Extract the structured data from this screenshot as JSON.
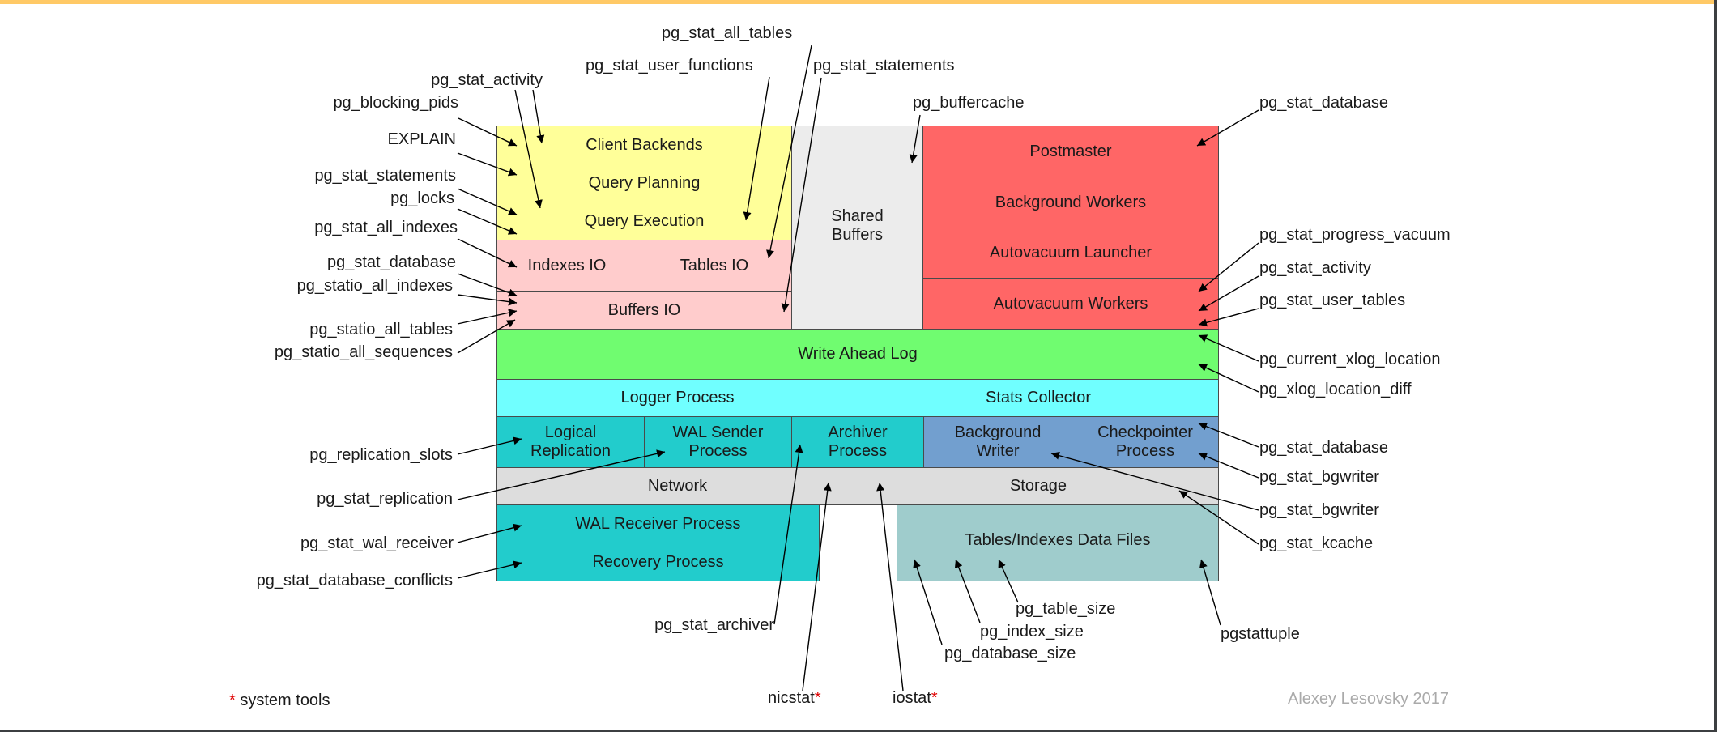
{
  "diagram": {
    "components": {
      "client_backends": "Client Backends",
      "query_planning": "Query Planning",
      "query_execution": "Query Execution",
      "indexes_io": "Indexes IO",
      "tables_io": "Tables IO",
      "buffers_io": "Buffers IO",
      "shared_buffers": "Shared Buffers",
      "postmaster": "Postmaster",
      "background_workers": "Background Workers",
      "autovacuum_launcher": "Autovacuum Launcher",
      "autovacuum_workers": "Autovacuum Workers",
      "write_ahead_log": "Write Ahead Log",
      "logger_process": "Logger Process",
      "stats_collector": "Stats Collector",
      "logical_replication": "Logical Replication",
      "wal_sender_process": "WAL Sender Process",
      "archiver_process": "Archiver Process",
      "background_writer": "Background Writer",
      "checkpointer_process": "Checkpointer Process",
      "network": "Network",
      "storage": "Storage",
      "wal_receiver_process": "WAL Receiver Process",
      "recovery_process": "Recovery Process",
      "data_files": "Tables/Indexes Data Files"
    },
    "colors": {
      "client_side": "#ffff99",
      "io": "#ffcccc",
      "shared_buffers": "#ececec",
      "server_processes": "#ff6666",
      "wal": "#70fc70",
      "logger_stats": "#70ffff",
      "replication": "#22cccc",
      "writers": "#729fcf",
      "network_storage": "#dddddd",
      "data_files": "#9fcccc",
      "top_bar": "#ffc966"
    },
    "labels": {
      "left": [
        "pg_stat_activity",
        "pg_blocking_pids",
        "EXPLAIN",
        "pg_stat_statements",
        "pg_locks",
        "pg_stat_all_indexes",
        "pg_stat_database",
        "pg_statio_all_indexes",
        "pg_statio_all_tables",
        "pg_statio_all_sequences",
        "pg_replication_slots",
        "pg_stat_replication",
        "pg_stat_wal_receiver",
        "pg_stat_database_conflicts"
      ],
      "top": [
        "pg_stat_all_tables",
        "pg_stat_user_functions",
        "pg_stat_statements",
        "pg_buffercache"
      ],
      "right": [
        "pg_stat_database",
        "pg_stat_progress_vacuum",
        "pg_stat_activity",
        "pg_stat_user_tables",
        "pg_current_xlog_location",
        "pg_xlog_location_diff",
        "pg_stat_database",
        "pg_stat_bgwriter",
        "pg_stat_bgwriter",
        "pg_stat_kcache"
      ],
      "bottom": [
        "pg_table_size",
        "pg_index_size",
        "pg_database_size",
        "pgstattuple",
        "pg_stat_archiver",
        "nicstat",
        "iostat"
      ]
    },
    "system_tool_marker": "*",
    "footnote": "system tools",
    "signature": "Alexey Lesovsky 2017"
  }
}
